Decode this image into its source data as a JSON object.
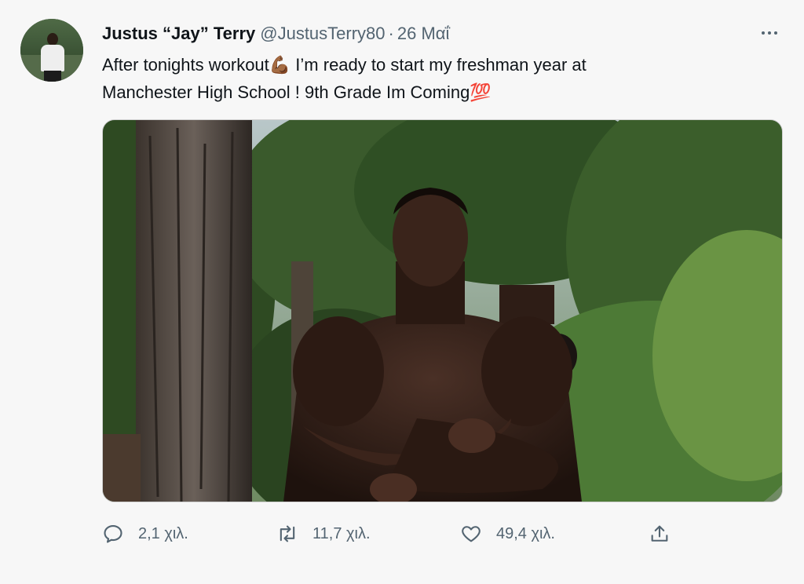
{
  "tweet": {
    "display_name": "Justus “Jay” Terry",
    "handle": "@JustusTerry80",
    "separator": "·",
    "date": "26 Μαΐ",
    "text_line1_a": "After tonights workout",
    "text_line1_emoji": "💪🏾",
    "text_line1_b": " I’m ready to start my freshman year at",
    "text_line2_a": "Manchester High School ! 9th Grade Im Coming",
    "text_line2_emoji": "💯"
  },
  "actions": {
    "reply_icon": "reply-icon",
    "reply_count": "2,1 χιλ.",
    "retweet_icon": "retweet-icon",
    "retweet_count": "11,7 χιλ.",
    "like_icon": "heart-icon",
    "like_count": "49,4 χιλ.",
    "share_icon": "share-icon"
  },
  "colors": {
    "text": "#0f1419",
    "secondary": "#536471",
    "background": "#f7f7f7"
  }
}
